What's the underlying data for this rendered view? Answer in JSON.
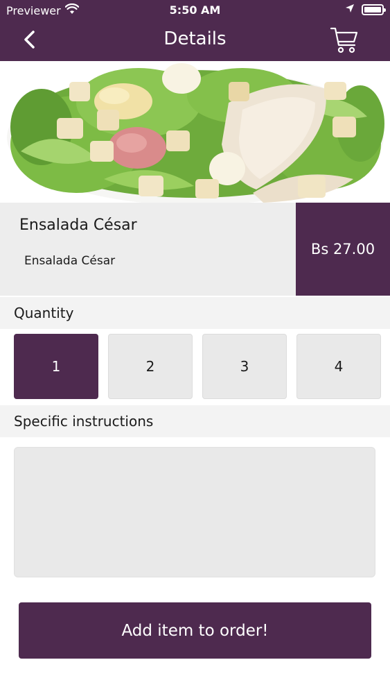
{
  "status_bar": {
    "carrier": "Previewer",
    "time": "5:50 AM"
  },
  "nav": {
    "title": "Details"
  },
  "item": {
    "name": "Ensalada César",
    "description": "Ensalada César",
    "price": "Bs 27.00"
  },
  "quantity": {
    "label": "Quantity",
    "options": [
      "1",
      "2",
      "3",
      "4"
    ],
    "selected": "1"
  },
  "instructions": {
    "label": "Specific instructions",
    "value": ""
  },
  "action": {
    "add_label": "Add item to order!"
  },
  "colors": {
    "brand": "#4e2a4f",
    "panel": "#ededed",
    "button_bg": "#e9e9e9"
  },
  "icons": [
    "wifi-icon",
    "location-arrow-icon",
    "battery-icon",
    "back-chevron-icon",
    "cart-icon"
  ]
}
